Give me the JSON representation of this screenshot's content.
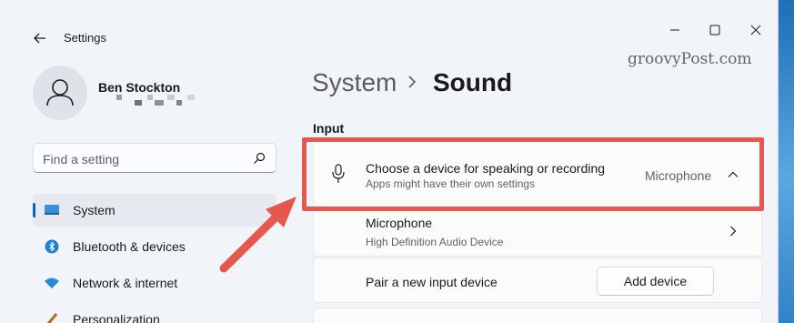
{
  "app": {
    "title": "Settings"
  },
  "colors": {
    "accent": "#0067c0",
    "annotation": "#e4584f",
    "window_bg": "#f1f4f9"
  },
  "user": {
    "name": "Ben Stockton",
    "avatar_icon": "person-icon"
  },
  "search": {
    "placeholder": "Find a setting",
    "icon": "search-icon"
  },
  "sidebar": {
    "items": [
      {
        "label": "System",
        "icon": "monitor-icon",
        "active": true
      },
      {
        "label": "Bluetooth & devices",
        "icon": "bluetooth-icon",
        "active": false
      },
      {
        "label": "Network & internet",
        "icon": "wifi-icon",
        "active": false
      },
      {
        "label": "Personalization",
        "icon": "brush-icon",
        "active": false
      }
    ]
  },
  "breadcrumb": {
    "parent": "System",
    "current": "Sound"
  },
  "watermark": "groovyPost.com",
  "input": {
    "section_label": "Input",
    "device_chooser": {
      "title": "Choose a device for speaking or recording",
      "subtitle": "Apps might have their own settings",
      "value": "Microphone"
    },
    "microphone": {
      "title": "Microphone",
      "subtitle": "High Definition Audio Device"
    },
    "pair": {
      "title": "Pair a new input device",
      "button": "Add device"
    }
  }
}
